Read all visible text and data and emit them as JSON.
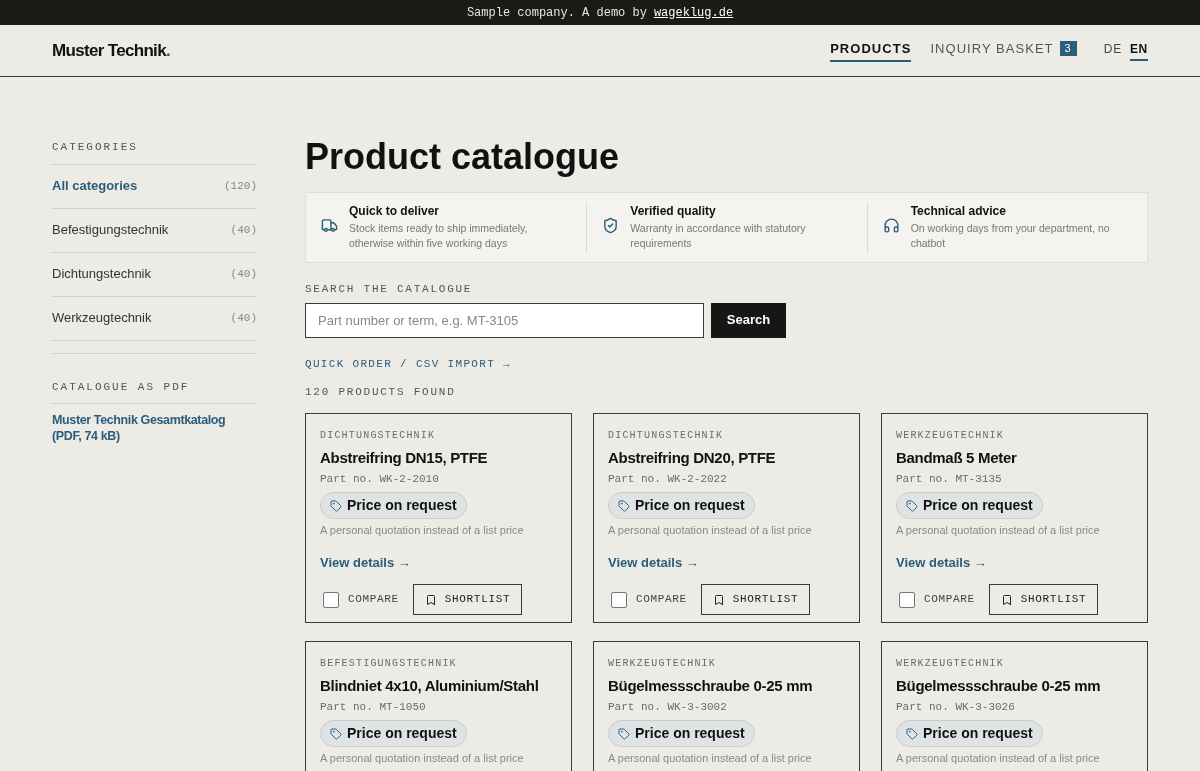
{
  "banner": {
    "text": "Sample company. A demo by",
    "link": "wageklug.de"
  },
  "header": {
    "logo": "Muster Technik",
    "logo_dot": ".",
    "nav": [
      {
        "label": "PRODUCTS",
        "selected": true
      },
      {
        "label": "INQUIRY BASKET",
        "selected": false,
        "count": "3"
      }
    ],
    "languages": [
      {
        "label": "DE",
        "selected": false
      },
      {
        "label": "EN",
        "selected": true
      }
    ]
  },
  "sidebar": {
    "categories_title": "CATEGORIES",
    "categories": [
      {
        "label": "All categories",
        "count": "(120)",
        "selected": true
      },
      {
        "label": "Befestigungstechnik",
        "count": "(40)",
        "selected": false
      },
      {
        "label": "Dichtungstechnik",
        "count": "(40)",
        "selected": false
      },
      {
        "label": "Werkzeugtechnik",
        "count": "(40)",
        "selected": false
      }
    ],
    "pdf_title": "CATALOGUE AS PDF",
    "pdf_link": "Muster Technik Gesamtkatalog (PDF, 74 kB)"
  },
  "page_title": "Product catalogue",
  "features": [
    {
      "kind": "truck",
      "title": "Quick to deliver",
      "text": "Stock items ready to ship immediately, otherwise within five working days"
    },
    {
      "kind": "shield",
      "title": "Verified quality",
      "text": "Warranty in accordance with statutory requirements"
    },
    {
      "kind": "headset",
      "title": "Technical advice",
      "text": "On working days from your department, no chatbot"
    }
  ],
  "search": {
    "label": "SEARCH THE CATALOGUE",
    "placeholder": "Part number or term, e.g. MT-3105",
    "button": "Search"
  },
  "quick_order": "QUICK ORDER / CSV IMPORT →",
  "result_count": "120 PRODUCTS FOUND",
  "products": [
    {
      "category": "DICHTUNGSTECHNIK",
      "name": "Abstreifring DN15, PTFE",
      "part": "Part no. WK-2-2010",
      "price": "Price on request",
      "note": "A personal quotation instead of a list price",
      "details": "View details →",
      "compare": "COMPARE",
      "compared": false,
      "shortlist": "SHORTLIST"
    },
    {
      "category": "DICHTUNGSTECHNIK",
      "name": "Abstreifring DN20, PTFE",
      "part": "Part no. WK-2-2022",
      "price": "Price on request",
      "note": "A personal quotation instead of a list price",
      "details": "View details →",
      "compare": "COMPARE",
      "compared": false,
      "shortlist": "SHORTLIST"
    },
    {
      "category": "WERKZEUGTECHNIK",
      "name": "Bandmaß 5 Meter",
      "part": "Part no. MT-3135",
      "price": "Price on request",
      "note": "A personal quotation instead of a list price",
      "details": "View details →",
      "compare": "COMPARE",
      "compared": false,
      "shortlist": "SHORTLIST"
    },
    {
      "category": "BEFESTIGUNGSTECHNIK",
      "name": "Blindniet 4x10, Aluminium/Stahl",
      "part": "Part no. MT-1050",
      "price": "Price on request",
      "note": "A personal quotation instead of a list price"
    },
    {
      "category": "WERKZEUGTECHNIK",
      "name": "Bügelmessschraube 0-25 mm",
      "part": "Part no. WK-3-3002",
      "price": "Price on request",
      "note": "A personal quotation instead of a list price"
    },
    {
      "category": "WERKZEUGTECHNIK",
      "name": "Bügelmessschraube 0-25 mm",
      "part": "Part no. WK-3-3026",
      "price": "Price on request",
      "note": "A personal quotation instead of a list price"
    }
  ]
}
